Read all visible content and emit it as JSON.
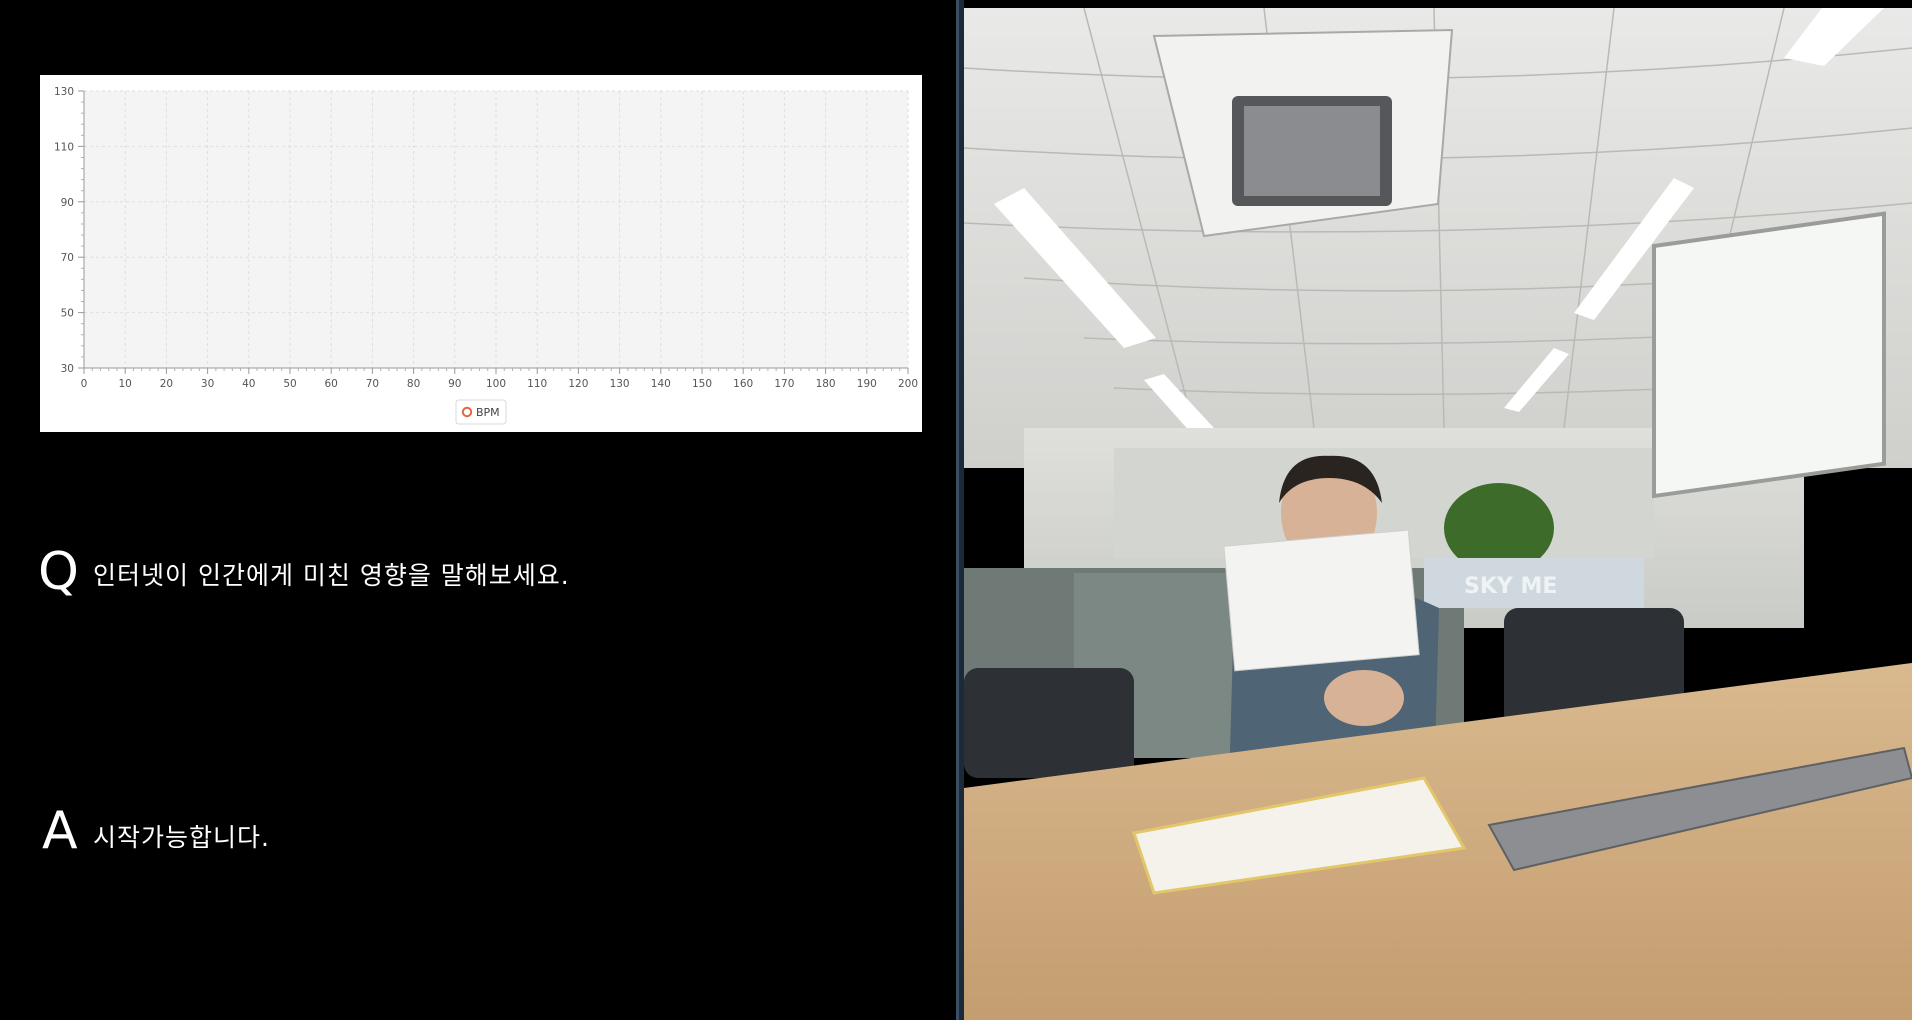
{
  "chart_data": {
    "type": "line",
    "x_ticks": [
      "0",
      "10",
      "20",
      "30",
      "40",
      "50",
      "60",
      "70",
      "80",
      "90",
      "100",
      "110",
      "120",
      "130",
      "140",
      "150",
      "160",
      "170",
      "180",
      "190",
      "200"
    ],
    "y_ticks": [
      "130",
      "110",
      "90",
      "70",
      "50",
      "30"
    ],
    "xlim": [
      0,
      200
    ],
    "ylim": [
      30,
      130
    ],
    "grid": true,
    "legend_position": "bottom-center",
    "series": [
      {
        "name": "BPM",
        "color": "#e8643c",
        "x": [],
        "y": []
      }
    ]
  },
  "qa": {
    "question_letter": "Q",
    "question_text": "인터넷이 인간에게 미친 영향을 말해보세요.",
    "answer_letter": "A",
    "answer_text": "시작가능합니다."
  },
  "video": {
    "signage_text": "SKY   ME"
  },
  "colors": {
    "background": "#000000",
    "chart_bg": "#f4f4f4",
    "legend_marker": "#e8643c"
  }
}
